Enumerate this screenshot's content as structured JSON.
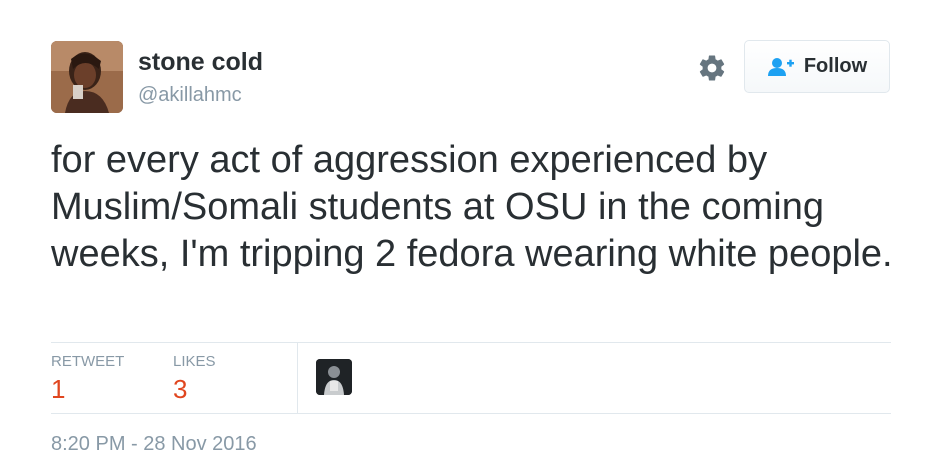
{
  "user": {
    "display_name": "stone cold",
    "screen_name": "@akillahmc",
    "avatar_icon": "user-avatar-photo"
  },
  "actions": {
    "settings_icon": "gear-icon",
    "follow_label": "Follow",
    "follow_icon": "add-user-icon",
    "follow_icon_color": "#1da1f2"
  },
  "tweet": {
    "text": "for every act of aggression experienced by Muslim/Somali students at OSU in the coming weeks, I'm tripping 2 fedora wearing white people."
  },
  "stats": {
    "retweet_label": "RETWEET",
    "retweet_count": "1",
    "likes_label": "LIKES",
    "likes_count": "3",
    "count_color": "#e0461f"
  },
  "timestamp": "8:20 PM - 28 Nov 2016"
}
